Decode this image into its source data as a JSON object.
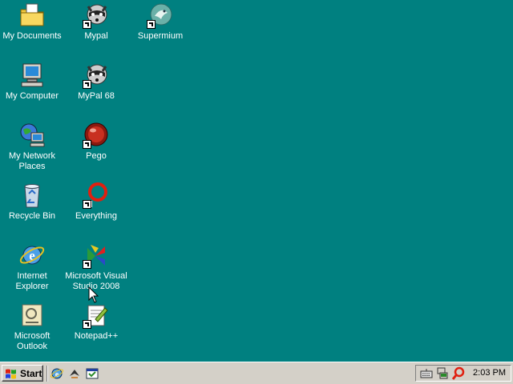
{
  "desktop": {
    "icons": [
      {
        "label": "My Documents",
        "icon": "folder-documents-icon"
      },
      {
        "label": "Mypal",
        "icon": "raccoon-icon"
      },
      {
        "label": "Supermium",
        "icon": "bird-globe-icon"
      },
      {
        "label": "My Computer",
        "icon": "computer-icon"
      },
      {
        "label": "MyPal 68",
        "icon": "raccoon-icon"
      },
      {
        "label": "My Network Places",
        "icon": "network-places-icon"
      },
      {
        "label": "Pego",
        "icon": "pego-icon"
      },
      {
        "label": "Recycle Bin",
        "icon": "recycle-bin-icon"
      },
      {
        "label": "Everything",
        "icon": "everything-search-icon"
      },
      {
        "label": "Internet Explorer",
        "icon": "internet-explorer-icon"
      },
      {
        "label": "Microsoft Visual Studio 2008",
        "icon": "visual-studio-icon"
      },
      {
        "label": "Microsoft Outlook",
        "icon": "outlook-icon"
      },
      {
        "label": "Notepad++",
        "icon": "notepad-plus-plus-icon"
      }
    ]
  },
  "taskbar": {
    "start_label": "Start",
    "quick_launch": [
      "internet-explorer-icon",
      "winamp-icon",
      "show-desktop-icon"
    ],
    "tray_icons": [
      "keyboard-icon",
      "network-icon",
      "search-tray-icon"
    ],
    "clock": "2:03 PM"
  },
  "colors": {
    "desktop": "#008080",
    "taskbar": "#d4d0c8"
  }
}
